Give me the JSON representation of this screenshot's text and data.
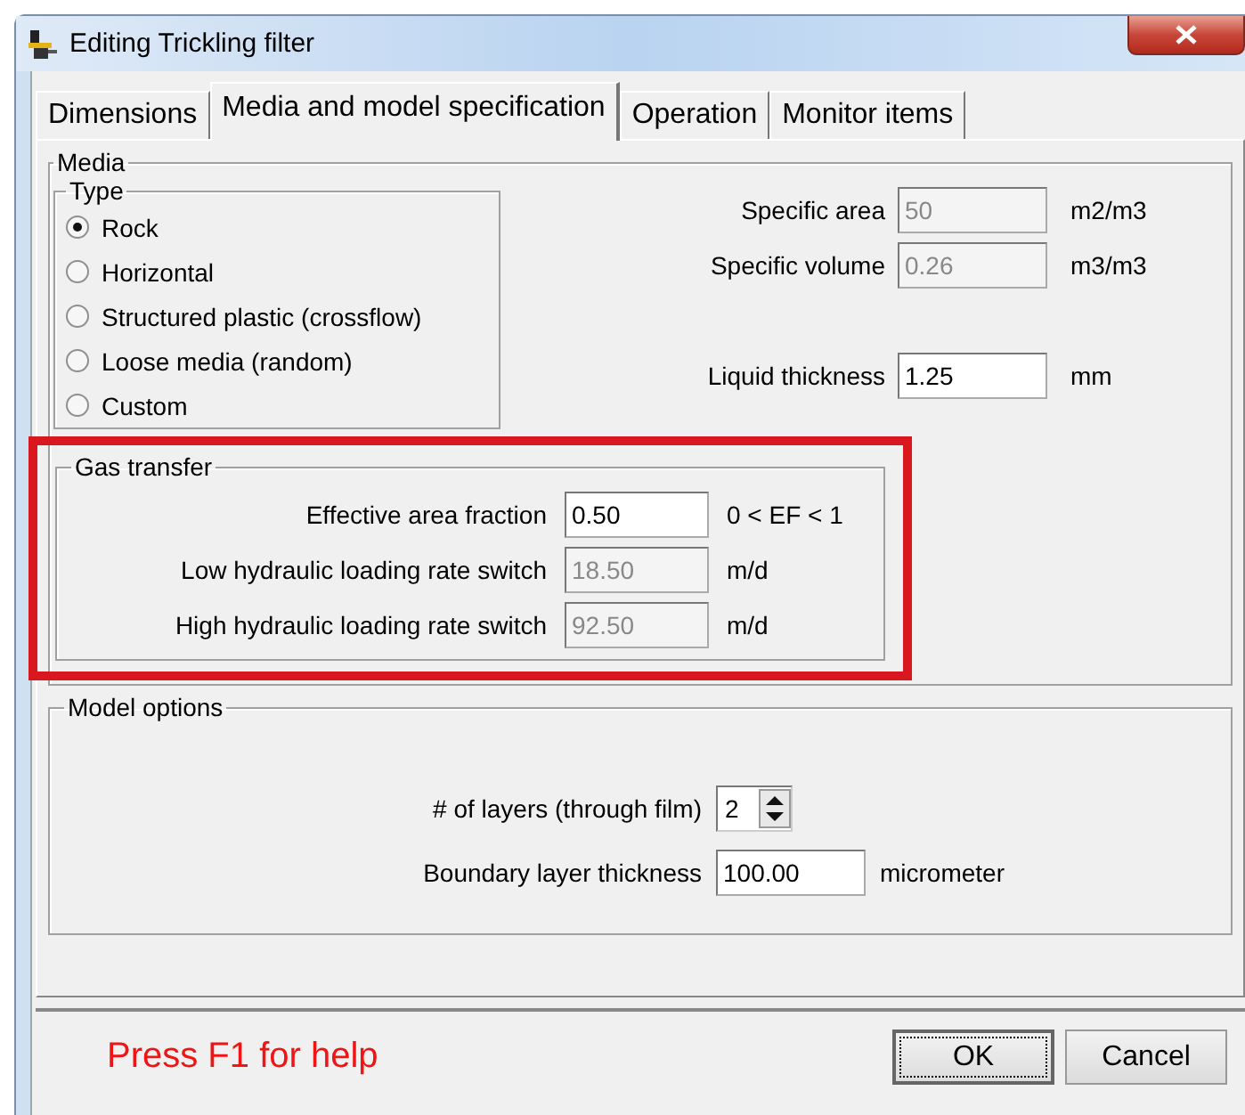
{
  "window": {
    "title": "Editing Trickling filter"
  },
  "tabs": [
    {
      "label": "Dimensions",
      "selected": false
    },
    {
      "label": "Media and model specification",
      "selected": true
    },
    {
      "label": "Operation",
      "selected": false
    },
    {
      "label": "Monitor items",
      "selected": false
    }
  ],
  "media": {
    "legend": "Media",
    "type": {
      "legend": "Type",
      "options": [
        {
          "label": "Rock",
          "selected": true
        },
        {
          "label": "Horizontal",
          "selected": false
        },
        {
          "label": "Structured plastic (crossflow)",
          "selected": false
        },
        {
          "label": "Loose media (random)",
          "selected": false
        },
        {
          "label": "Custom",
          "selected": false
        }
      ]
    },
    "fields": [
      {
        "label": "Specific area",
        "value": "50",
        "unit": "m2/m3",
        "disabled": true
      },
      {
        "label": "Specific volume",
        "value": "0.26",
        "unit": "m3/m3",
        "disabled": true
      },
      {
        "label": "Liquid thickness",
        "value": "1.25",
        "unit": "mm",
        "disabled": false
      }
    ]
  },
  "gas_transfer": {
    "legend": "Gas transfer",
    "highlighted": true,
    "fields": [
      {
        "label": "Effective area fraction",
        "value": "0.50",
        "unit": "0 < EF < 1",
        "disabled": false
      },
      {
        "label": "Low hydraulic loading rate switch",
        "value": "18.50",
        "unit": "m/d",
        "disabled": true
      },
      {
        "label": "High hydraulic loading rate switch",
        "value": "92.50",
        "unit": "m/d",
        "disabled": true
      }
    ]
  },
  "model_options": {
    "legend": "Model options",
    "layers": {
      "label": "# of layers (through film)",
      "value": "2"
    },
    "fields": [
      {
        "label": "Boundary layer thickness",
        "value": "100.00",
        "unit": "micrometer",
        "disabled": false
      }
    ]
  },
  "help": "Press F1 for help",
  "buttons": [
    {
      "label": "OK",
      "default": true
    },
    {
      "label": "Cancel",
      "default": false
    }
  ]
}
